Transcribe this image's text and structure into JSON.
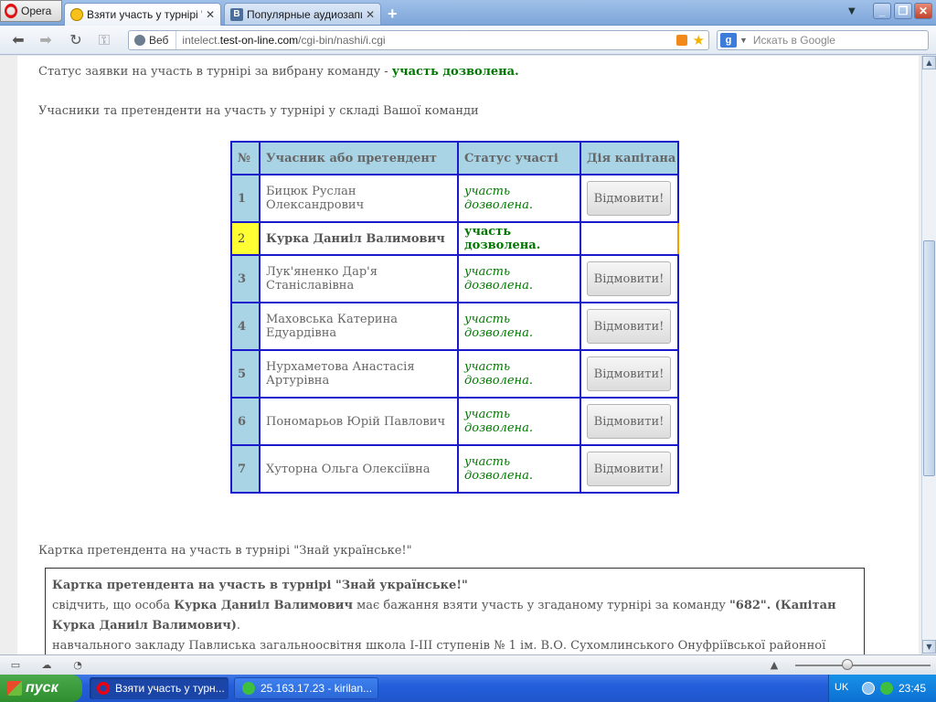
{
  "browser": {
    "opera_label": "Opera",
    "tabs": [
      {
        "title": "Взяти участь у турнірі \"...",
        "close": "✕"
      },
      {
        "title": "Популярные аудиозаписи",
        "close": "✕"
      }
    ],
    "newtab": "+",
    "address": {
      "mode": "Веб",
      "url_prefix": "intelect.",
      "url_host": "test-on-line.com",
      "url_path": "/cgi-bin/nashi/i.cgi"
    },
    "search": {
      "placeholder": "Искать в Google"
    }
  },
  "page": {
    "status_line_prefix": "Статус заявки на участь в турнірі за вибрану команду - ",
    "status_line_value": "участь дозволена.",
    "members_heading": "Учасники та претенденти на участь у турнірі у складі Вашої команди",
    "table": {
      "headers": [
        "№",
        "Учасник або претендент",
        "Статус участі",
        "Дія капітана"
      ],
      "rows": [
        {
          "num": "1",
          "name": "Бицюк Руслан Олександрович",
          "status": "участь дозволена.",
          "action": "Відмовити!"
        },
        {
          "num": "2",
          "name": "Курка Даниіл Валимович",
          "status": "участь дозволена.",
          "action": ""
        },
        {
          "num": "3",
          "name": "Лук'яненко Дар'я Станіславівна",
          "status": "участь дозволена.",
          "action": "Відмовити!"
        },
        {
          "num": "4",
          "name": "Маховська Катерина Едуардівна",
          "status": "участь дозволена.",
          "action": "Відмовити!"
        },
        {
          "num": "5",
          "name": "Нурхаметова Анастасія Артурівна",
          "status": "участь дозволена.",
          "action": "Відмовити!"
        },
        {
          "num": "6",
          "name": "Пономарьов Юрій Павлович",
          "status": "участь дозволена.",
          "action": "Відмовити!"
        },
        {
          "num": "7",
          "name": "Хуторна Ольга Олексіївна",
          "status": "участь дозволена.",
          "action": "Відмовити!"
        }
      ]
    },
    "card_heading": "Картка претендента на участь в турнірі \"Знай українське!\"",
    "card": {
      "title": "Картка претендента на участь в турнірі \"Знай українське!\"",
      "line1_a": "свідчить, що особа ",
      "line1_name": "Курка Даниіл Валимович",
      "line1_b": " має бажання взяти участь у згаданому турнірі за команду ",
      "line1_team": "\"682\". (Капітан Курка Даниіл Валимович)",
      "line1_end": ".",
      "line2": "навчального закладу Павлиська загальноосвітня школа I-III ступенів № 1 ім. В.О. Сухомлинського Онуфріївської районної ради"
    }
  },
  "taskbar": {
    "start": "пуск",
    "tasks": [
      "Взяти участь у турн...",
      "25.163.17.23 - kirilan..."
    ],
    "lang": "UK",
    "clock": "23:45"
  },
  "colors": {
    "accent_green": "#007700",
    "table_border": "#1a1acc",
    "header_bg": "#a8d4e6",
    "highlight": "#ffff33"
  }
}
